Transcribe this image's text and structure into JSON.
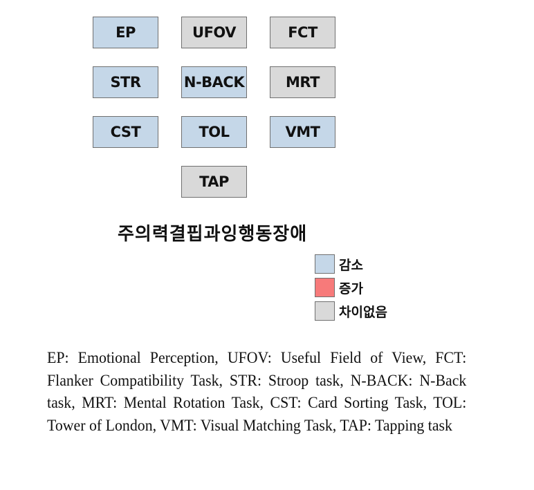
{
  "colors": {
    "decrease": "#c5d7e8",
    "increase": "#f77a7a",
    "no_difference": "#d9d9d9"
  },
  "boxes": [
    {
      "label": "EP",
      "status": "decrease"
    },
    {
      "label": "UFOV",
      "status": "nodiff"
    },
    {
      "label": "FCT",
      "status": "nodiff"
    },
    {
      "label": "STR",
      "status": "decrease"
    },
    {
      "label": "N-BACK",
      "status": "decrease"
    },
    {
      "label": "MRT",
      "status": "nodiff"
    },
    {
      "label": "CST",
      "status": "decrease"
    },
    {
      "label": "TOL",
      "status": "decrease"
    },
    {
      "label": "VMT",
      "status": "decrease"
    },
    {
      "label": "TAP",
      "status": "nodiff"
    }
  ],
  "title": "주의력결핍과잉행동장애",
  "legend": [
    {
      "label": "감소",
      "status": "decrease"
    },
    {
      "label": "증가",
      "status": "increase"
    },
    {
      "label": "차이없음",
      "status": "nodiff"
    }
  ],
  "caption": "EP: Emotional Perception, UFOV: Useful Field of View, FCT: Flanker Compatibility Task, STR: Stroop task, N-BACK: N-Back task, MRT: Mental Rotation Task, CST: Card Sorting Task, TOL: Tower of London, VMT: Visual Matching Task, TAP: Tapping task"
}
